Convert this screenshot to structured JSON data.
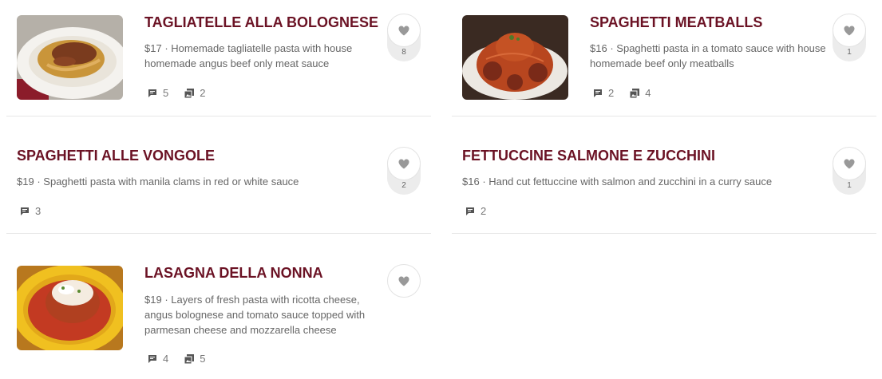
{
  "items": [
    {
      "title": "TAGLIATELLE ALLA BOLOGNESE",
      "price": "$17",
      "description": "Homemade tagliatelle pasta with house homemade angus beef only meat sauce",
      "comments": "5",
      "photos": "2",
      "likes": "8",
      "image": "tagliatelle-photo"
    },
    {
      "title": "SPAGHETTI MEATBALLS",
      "price": "$16",
      "description": "Spaghetti pasta in a tomato sauce with house homemade beef only meatballs",
      "comments": "2",
      "photos": "4",
      "likes": "1",
      "image": "spaghetti-meatballs-photo"
    },
    {
      "title": "SPAGHETTI ALLE VONGOLE",
      "price": "$19",
      "description": "Spaghetti pasta with manila clams in red or white sauce",
      "comments": "3",
      "likes": "2"
    },
    {
      "title": "FETTUCCINE SALMONE E ZUCCHINI",
      "price": "$16",
      "description": "Hand cut fettuccine with salmon and zucchini in a curry sauce",
      "comments": "2",
      "likes": "1"
    },
    {
      "title": "LASAGNA DELLA NONNA",
      "price": "$19",
      "description": "Layers of fresh pasta with ricotta cheese, angus bolognese and tomato sauce topped with parmesan cheese and mozzarella cheese",
      "comments": "4",
      "photos": "5",
      "image": "lasagna-photo"
    }
  ],
  "separator": "·",
  "icons": {
    "comment": "comment-icon",
    "photo": "photo-icon",
    "like": "heart-icon"
  },
  "colors": {
    "title": "#6b1224",
    "text": "#666666",
    "divider": "#e6e6e6"
  }
}
